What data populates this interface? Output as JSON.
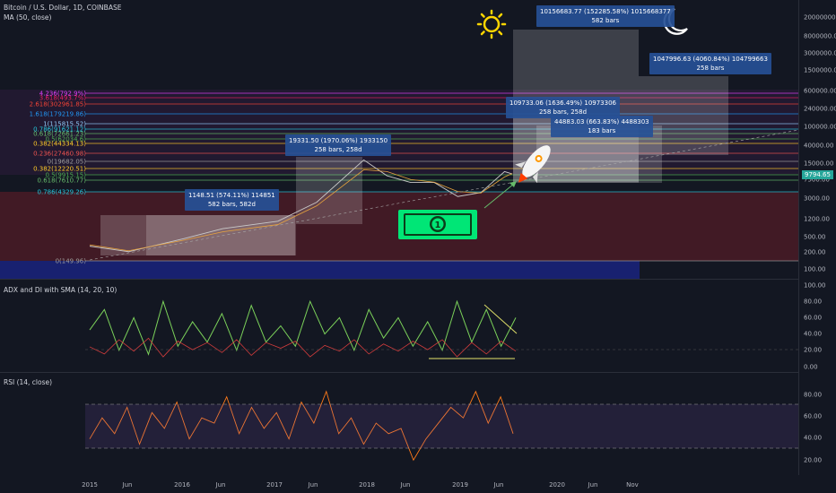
{
  "header": {
    "title": "Bitcoin / U.S. Dollar, 1D, COINBASE",
    "indicator_ma": "MA (50, close)",
    "indicator_adx": "ADX and DI with SMA (14, 20, 10)",
    "indicator_rsi": "RSI (14, close)"
  },
  "current_price": "9794.65",
  "colors": {
    "background": "#131722",
    "price": "#c9c9c9",
    "ma": "#e8a33d",
    "adx_green": "#7bd15a",
    "adx_red": "#d23c3c",
    "adx_line": "#e4e46a",
    "rsi": "#ff7a1a",
    "measure_box": "#ffffff",
    "label_bg": "#2a5aa0",
    "rocket_accent": "#ff9800",
    "dollar_green": "#00e676"
  },
  "icons": [
    "sun-icon",
    "moon-icon",
    "rocket-icon",
    "dollar-bill-icon"
  ],
  "measure_boxes": [
    {
      "line1": "1148.51 (574.11%) 114851",
      "line2": "582 bars, 582d"
    },
    {
      "line1": "19331.50 (1970.06%) 1933150",
      "line2": "258 bars, 258d"
    },
    {
      "line1": "109733.06 (1636.49%) 10973306",
      "line2": "258 bars, 258d"
    },
    {
      "line1": "44883.03 (663.83%) 4488303",
      "line2": "183 bars"
    },
    {
      "line1": "10156683.77 (152285.58%) 1015668377",
      "line2": "582 bars"
    },
    {
      "line1": "1047996.63 (4060.84%) 104799663",
      "line2": "258 bars"
    }
  ],
  "fib_levels": [
    {
      "label": "4.236(792.9%)",
      "color": "#e040fb",
      "price": 792
    },
    {
      "label": "3.618(493.7%)",
      "color": "#e91e63",
      "price": 493
    },
    {
      "label": "2.618(302961.85)",
      "color": "#f44336",
      "price": 302961
    },
    {
      "label": "1.618(179219.86)",
      "color": "#2196f3",
      "price": 179219
    },
    {
      "label": "1(115815.52)",
      "color": "#90caf9",
      "price": 115815
    },
    {
      "label": "0.786(91621.12)",
      "color": "#26c6da",
      "price": 91621
    },
    {
      "label": "0.618(72661.23)",
      "color": "#66bb6a",
      "price": 72661
    },
    {
      "label": "0.5(62034.6)",
      "color": "#4caf50",
      "price": 62034
    },
    {
      "label": "0.382(44334.13)",
      "color": "#ffca28",
      "price": 44334
    },
    {
      "label": "0.236(27460.98)",
      "color": "#ef5350",
      "price": 27460
    },
    {
      "label": "0(19682.05)",
      "color": "#9e9e9e",
      "price": 19682
    },
    {
      "label": "0.382(12220.51)",
      "color": "#ffca28",
      "price": 12220
    },
    {
      "label": "0.5(9915.15)",
      "color": "#4caf50",
      "price": 9915
    },
    {
      "label": "0.618(7610.77)",
      "color": "#66bb6a",
      "price": 7610
    },
    {
      "label": "0.786(4329.26)",
      "color": "#26c6da",
      "price": 4329
    },
    {
      "label": "0(149.96)",
      "color": "#9e9e9e",
      "price": 150
    }
  ],
  "chart_data": [
    {
      "type": "line",
      "title": "Bitcoin / U.S. Dollar, 1D, COINBASE",
      "y_scale": "log",
      "y_ticks": [
        "20000000.00",
        "8000000.00",
        "3000000.00",
        "1500000.00",
        "600000.00",
        "240000.00",
        "100000.00",
        "40000.00",
        "15000.00",
        "7500.00",
        "3000.00",
        "1200.00",
        "500.00",
        "200.00",
        "100.00"
      ],
      "x_ticks": [
        "2015",
        "Jun",
        "2016",
        "Jun",
        "2017",
        "Jun",
        "2018",
        "Jun",
        "2019",
        "Jun",
        "2020",
        "Jun",
        "Nov"
      ],
      "series": [
        {
          "name": "Bitcoin / U.S. Dollar",
          "x": [
            "2015-01",
            "2015-06",
            "2016-01",
            "2016-06",
            "2017-01",
            "2017-06",
            "2017-12",
            "2018-03",
            "2018-06",
            "2018-09",
            "2018-12",
            "2019-03",
            "2019-06",
            "2019-07"
          ],
          "values": [
            300,
            230,
            430,
            700,
            1000,
            2500,
            19300,
            9000,
            6500,
            6500,
            3300,
            4000,
            11000,
            9794.65
          ]
        },
        {
          "name": "MA (50, close)",
          "x": [
            "2015-01",
            "2015-06",
            "2016-01",
            "2016-06",
            "2017-01",
            "2017-06",
            "2017-12",
            "2018-03",
            "2018-06",
            "2018-09",
            "2018-12",
            "2019-03",
            "2019-06",
            "2019-07"
          ],
          "values": [
            320,
            240,
            400,
            600,
            850,
            2100,
            12000,
            11000,
            7500,
            6600,
            4200,
            3900,
            8500,
            10000
          ]
        }
      ]
    },
    {
      "type": "line",
      "title": "ADX and DI with SMA (14, 20, 10)",
      "ylim": [
        0,
        100
      ],
      "y_ticks": [
        "100.00",
        "80.00",
        "60.00",
        "40.00",
        "20.00",
        "0.00"
      ],
      "series": [
        {
          "name": "ADX",
          "values": [
            45,
            70,
            20,
            60,
            15,
            80,
            25,
            55,
            30,
            65,
            20,
            75,
            30,
            50,
            25,
            80,
            40,
            60,
            20,
            70,
            35,
            60,
            25,
            55,
            20,
            80,
            30,
            70,
            25,
            60
          ]
        }
      ]
    },
    {
      "type": "line",
      "title": "RSI (14, close)",
      "ylim": [
        10,
        95
      ],
      "y_ticks": [
        "80.00",
        "60.00",
        "40.00",
        "20.00"
      ],
      "series": [
        {
          "name": "RSI",
          "values": [
            40,
            60,
            45,
            70,
            35,
            65,
            50,
            75,
            40,
            60,
            55,
            80,
            45,
            70,
            50,
            65,
            40,
            75,
            55,
            85,
            45,
            60,
            35,
            55,
            45,
            50,
            20,
            40,
            55,
            70,
            60,
            85,
            55,
            80,
            45
          ]
        }
      ]
    }
  ]
}
